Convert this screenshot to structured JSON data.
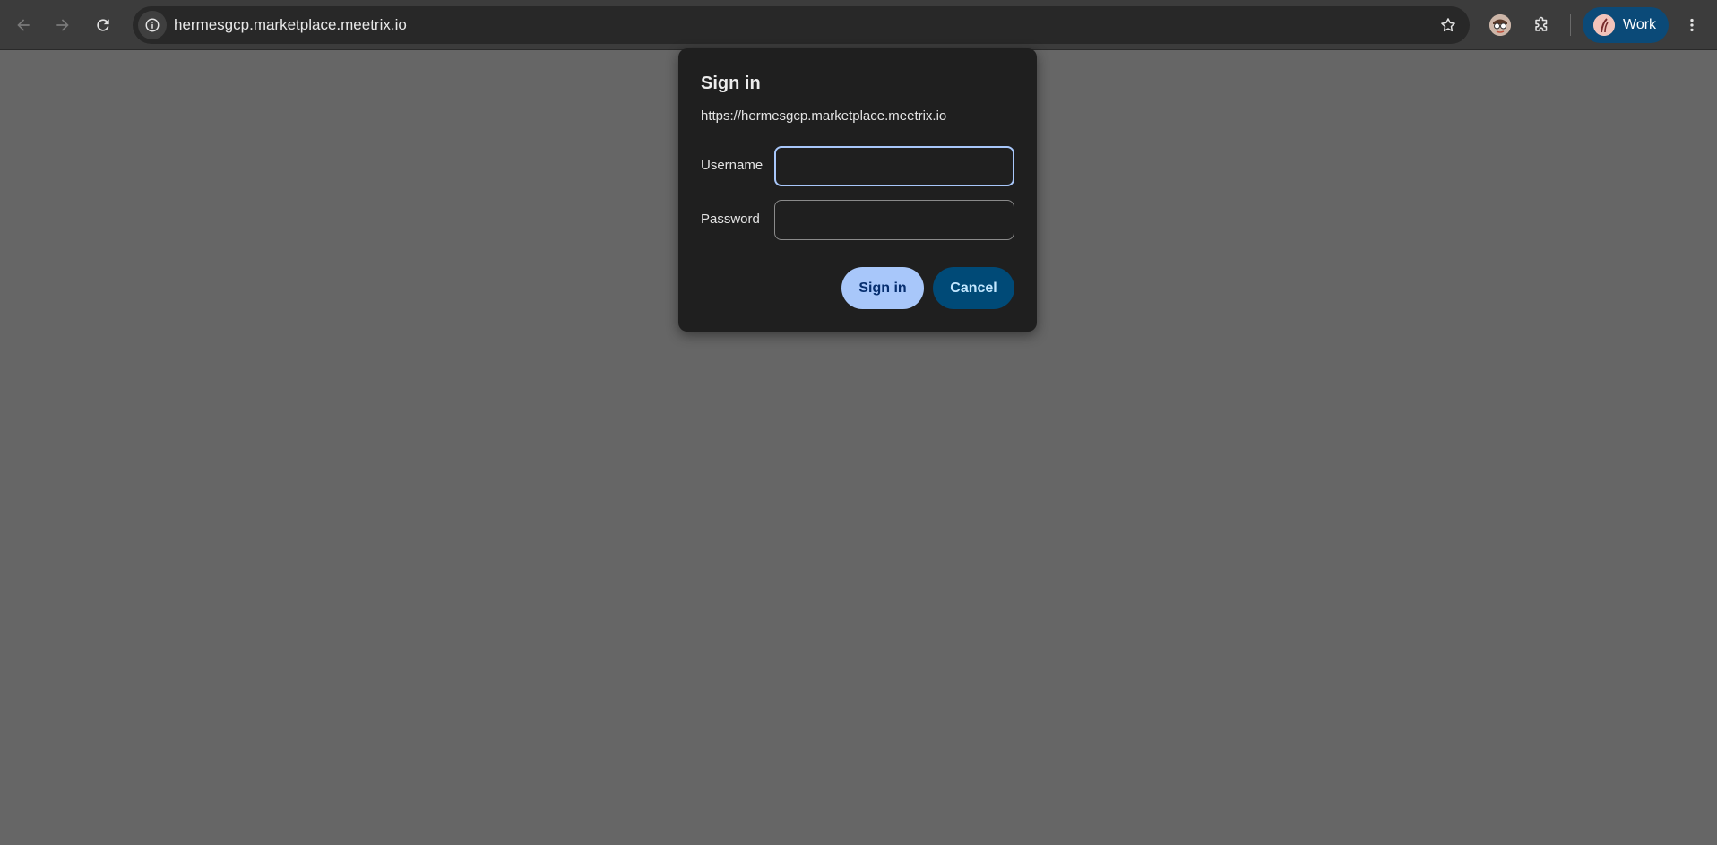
{
  "toolbar": {
    "back_icon": "arrow-left-icon",
    "forward_icon": "arrow-right-icon",
    "reload_icon": "reload-icon",
    "url": "hermesgcp.marketplace.meetrix.io",
    "site_info_icon": "info-icon",
    "bookmark_icon": "star-icon",
    "extension_avatar_icon": "extension-avatar-icon",
    "extensions_icon": "puzzle-icon",
    "profile": {
      "label": "Work",
      "color": "#0b4a78"
    },
    "menu_icon": "kebab-menu-icon"
  },
  "dialog": {
    "title": "Sign in",
    "origin": "https://hermesgcp.marketplace.meetrix.io",
    "username_label": "Username",
    "username_value": "",
    "password_label": "Password",
    "password_value": "",
    "signin_label": "Sign in",
    "cancel_label": "Cancel",
    "accent_color": "#a8c7fa"
  },
  "page": {
    "background_color": "#666666"
  }
}
